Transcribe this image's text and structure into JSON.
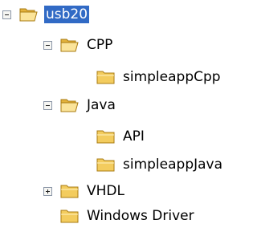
{
  "tree": {
    "root": {
      "label": "usb20",
      "selected": true,
      "expanded": true
    },
    "cpp": {
      "label": "CPP",
      "expanded": true
    },
    "simpleappCpp": {
      "label": "simpleappCpp"
    },
    "java": {
      "label": "Java",
      "expanded": true
    },
    "api": {
      "label": "API"
    },
    "simpleappJava": {
      "label": "simpleappJava"
    },
    "vhdl": {
      "label": "VHDL",
      "expanded": false
    },
    "windowsDriver": {
      "label": "Windows Driver"
    }
  },
  "colors": {
    "selection": "#316ac5",
    "folder": "#f3cc5e",
    "folder_open": "#fbe49a"
  },
  "icons": {
    "folder_open": "folder-open-icon",
    "folder_closed": "folder-icon",
    "collapse": "minus-box-icon",
    "expand": "plus-box-icon"
  }
}
